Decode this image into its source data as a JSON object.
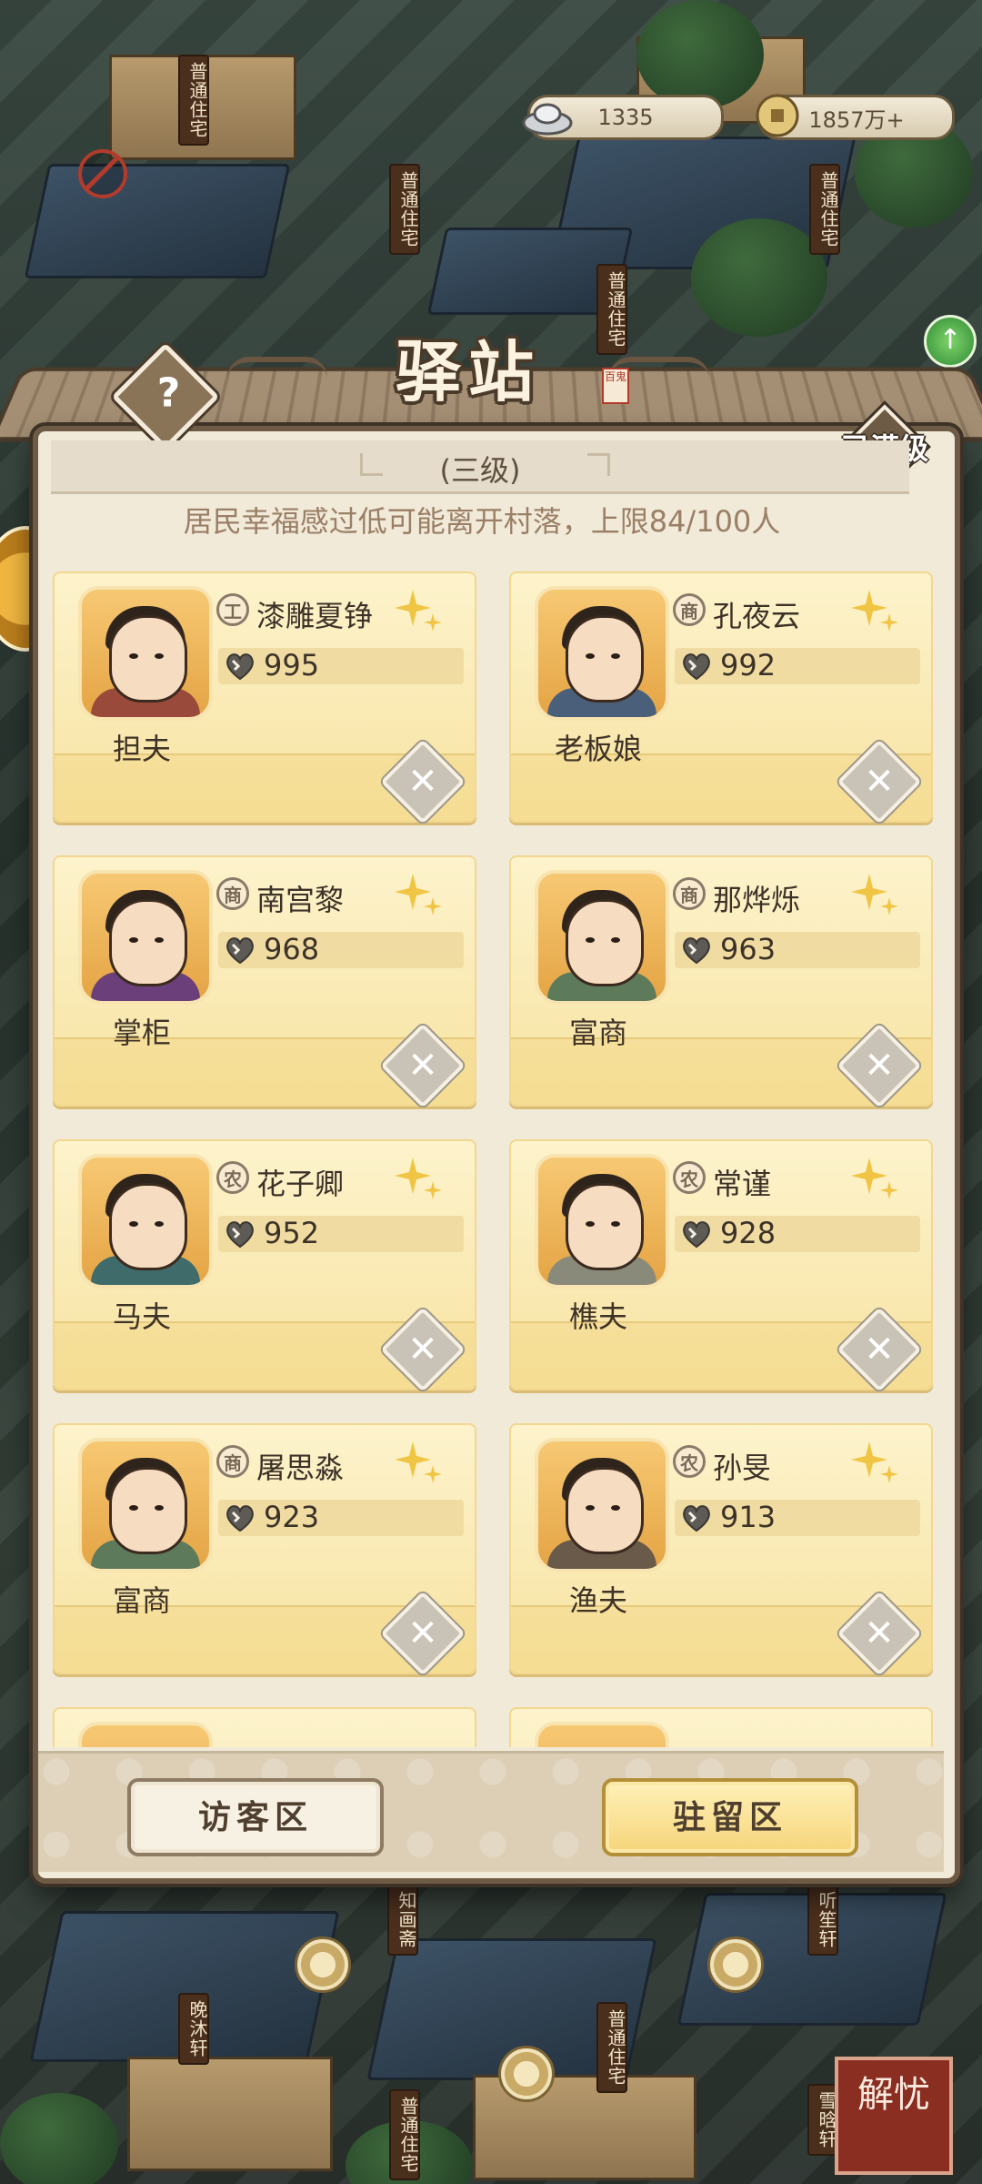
{
  "currency": {
    "silver": "1335",
    "copper": "1857万+"
  },
  "modal": {
    "title": "驿站",
    "seal_text": "百鬼",
    "help_label": "?",
    "level": "(三级)",
    "maxed_label": "已满级",
    "notice": "居民幸福感过低可能离开村落，上限84/100人"
  },
  "residents": [
    {
      "name": "漆雕夏铮",
      "badge": "工",
      "value": "995",
      "role": "担夫",
      "robe": "#9a4a3a"
    },
    {
      "name": "孔夜云",
      "badge": "商",
      "value": "992",
      "role": "老板娘",
      "robe": "#4a607a"
    },
    {
      "name": "南宫黎",
      "badge": "商",
      "value": "968",
      "role": "掌柜",
      "robe": "#6b3f7a"
    },
    {
      "name": "那烨烁",
      "badge": "商",
      "value": "963",
      "role": "富商",
      "robe": "#5d7a5a"
    },
    {
      "name": "花子卿",
      "badge": "农",
      "value": "952",
      "role": "马夫",
      "robe": "#3f6b6a"
    },
    {
      "name": "常谨",
      "badge": "农",
      "value": "928",
      "role": "樵夫",
      "robe": "#8a8a7a"
    },
    {
      "name": "屠思淼",
      "badge": "商",
      "value": "923",
      "role": "富商",
      "robe": "#5d7a5a"
    },
    {
      "name": "孙旻",
      "badge": "农",
      "value": "913",
      "role": "渔夫",
      "robe": "#6a5a4a"
    }
  ],
  "tabs": {
    "visitor": "访客区",
    "stay": "驻留区"
  },
  "map_labels": {
    "a": "普通住宅",
    "b": "普通住宅",
    "c": "普通住宅",
    "d": "普通住宅",
    "e": "知画斋",
    "f": "听笙轩",
    "g": "晚沐轩",
    "h": "普通住宅",
    "i": "雪晗轩",
    "j": "普通住宅"
  },
  "corner_button": "解忧",
  "colors": {
    "card_bg": "#f7e3a1",
    "frame": "#6e5b45",
    "accent_gold": "#f0b640"
  }
}
